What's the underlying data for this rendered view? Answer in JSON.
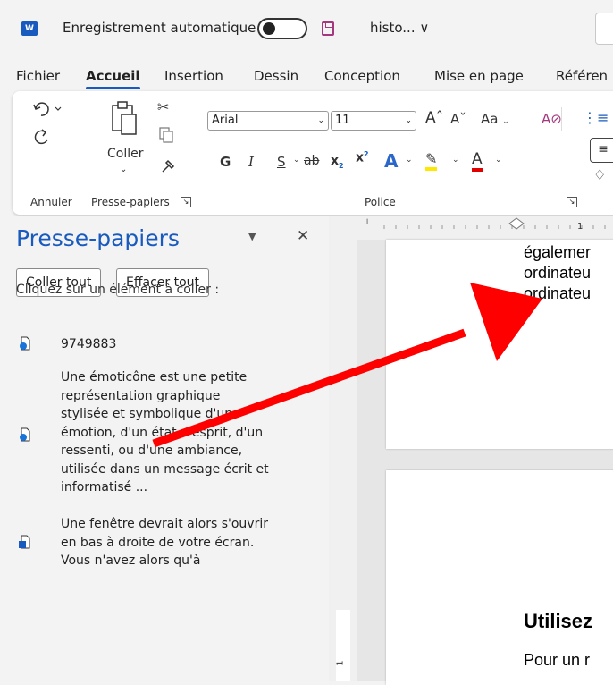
{
  "titlebar": {
    "autosave_label": "Enregistrement automatique",
    "filename": "histo... ∨"
  },
  "menu": [
    "Fichier",
    "Accueil",
    "Insertion",
    "Dessin",
    "Conception",
    "Mise en page",
    "Référen"
  ],
  "ribbon": {
    "coller": "Coller",
    "font_name": "Arial",
    "font_size": "11",
    "aa": "Aa",
    "group_annuler": "Annuler",
    "group_presse": "Presse-papiers",
    "group_police": "Police"
  },
  "clipboard_pane": {
    "title": "Presse-papiers",
    "btn_paste_all": "Coller tout",
    "btn_clear_all": "Effacer tout",
    "instruction": "Cliquez sur un élément à coller :",
    "items": [
      {
        "icon": "web-document-icon",
        "lines": [
          "9749883"
        ]
      },
      {
        "icon": "web-document-icon",
        "lines": [
          "Une émoticône est une petite",
          "représentation graphique",
          "stylisée et symbolique d'une",
          "émotion, d'un état d'esprit, d'un",
          "ressenti, ou d'une ambiance,",
          "utilisée dans un message écrit et",
          "informatisé ..."
        ]
      },
      {
        "icon": "word-document-icon",
        "lines": [
          "Une fenêtre devrait alors s'ouvrir",
          "en bas à droite de votre écran.",
          "Vous n'avez alors qu'à"
        ]
      }
    ]
  },
  "document": {
    "page1_lines": [
      "égalemer",
      "ordinateu",
      "ordinateu"
    ],
    "heading": "Utilisez",
    "body_line": "Pour un r"
  },
  "ruler_mark": "1",
  "colors": {
    "accent": "#185abd",
    "arrow": "#ff0000",
    "save": "#a4377d"
  }
}
